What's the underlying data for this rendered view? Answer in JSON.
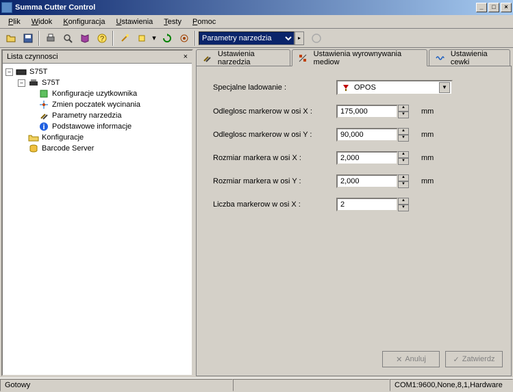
{
  "title": "Summa Cutter Control",
  "menu": {
    "plik": "Plik",
    "widok": "Widok",
    "konfiguracja": "Konfiguracja",
    "ustawienia": "Ustawienia",
    "testy": "Testy",
    "pomoc": "Pomoc"
  },
  "toolbar": {
    "combo_value": "Parametry narzedzia"
  },
  "left": {
    "header": "Lista czynnosci",
    "nodes": {
      "root": "S75T",
      "n1": "Konfiguracje uzytkownika",
      "n2": "Zmien poczatek wycinania",
      "n3": "Parametry narzedzia",
      "n4": "Podstawowe informacje",
      "n5": "Konfiguracje",
      "n6": "Barcode Server"
    }
  },
  "tabs": {
    "t1": "Ustawienia narzedzia",
    "t2": "Ustawienia wyrownywania mediow",
    "t3": "Ustawienia cewki"
  },
  "form": {
    "special_load_label": "Specjalne ladowanie :",
    "special_load_value": "OPOS",
    "dist_x_label": "Odleglosc markerow w osi X  :",
    "dist_x_value": "175,000",
    "dist_y_label": "Odleglosc markerow w osi Y :",
    "dist_y_value": "90,000",
    "size_x_label": "Rozmiar markera w osi X :",
    "size_x_value": "2,000",
    "size_y_label": "Rozmiar markera w osi Y :",
    "size_y_value": "2,000",
    "count_x_label": "Liczba markerow w osi X :",
    "count_x_value": "2",
    "unit": "mm"
  },
  "buttons": {
    "cancel": "Anuluj",
    "apply": "Zatwierdz"
  },
  "status": {
    "ready": "Gotowy",
    "port": "COM1:9600,None,8,1,Hardware"
  }
}
